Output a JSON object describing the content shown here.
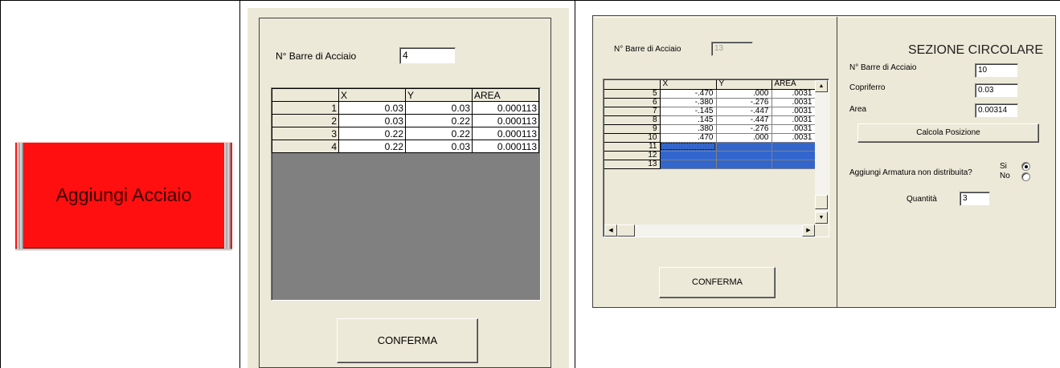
{
  "left_panel": {
    "button_label": "Aggiungi Acciaio"
  },
  "middle_form": {
    "bars_label": "N° Barre di Acciaio",
    "bars_value": "4",
    "table": {
      "headers": [
        "X",
        "Y",
        "AREA"
      ],
      "rows": [
        {
          "n": "1",
          "x": "0.03",
          "y": "0.03",
          "area": "0.000113"
        },
        {
          "n": "2",
          "x": "0.03",
          "y": "0.22",
          "area": "0.000113"
        },
        {
          "n": "3",
          "x": "0.22",
          "y": "0.22",
          "area": "0.000113"
        },
        {
          "n": "4",
          "x": "0.22",
          "y": "0.03",
          "area": "0.000113"
        }
      ]
    },
    "confirm_label": "CONFERMA"
  },
  "right_form": {
    "bars_label": "N° Barre di Acciaio",
    "bars_value": "13",
    "table": {
      "headers": [
        "X",
        "Y",
        "AREA"
      ],
      "rows": [
        {
          "n": "5",
          "x": "-.470",
          "y": ".000",
          "area": ".0031"
        },
        {
          "n": "6",
          "x": "-.380",
          "y": "-.276",
          "area": ".0031"
        },
        {
          "n": "7",
          "x": "-.145",
          "y": "-.447",
          "area": ".0031"
        },
        {
          "n": "8",
          "x": ".145",
          "y": "-.447",
          "area": ".0031"
        },
        {
          "n": "9",
          "x": ".380",
          "y": "-.276",
          "area": ".0031"
        },
        {
          "n": "10",
          "x": ".470",
          "y": ".000",
          "area": ".0031"
        },
        {
          "n": "11",
          "x": "",
          "y": "",
          "area": ""
        },
        {
          "n": "12",
          "x": "",
          "y": "",
          "area": ""
        },
        {
          "n": "13",
          "x": "",
          "y": "",
          "area": ""
        }
      ]
    },
    "confirm_label": "CONFERMA",
    "section": {
      "title": "SEZIONE CIRCOLARE",
      "bars_label": "N° Barre di Acciaio",
      "bars_value": "10",
      "cover_label": "Copriferro",
      "cover_value": "0.03",
      "area_label": "Area",
      "area_value": "0.00314",
      "calc_button": "Calcola Posizione",
      "extra_question": "Aggiungi  Armatura non distribuita?",
      "yes_label": "Si",
      "no_label": "No",
      "yes_selected": true,
      "quantity_label": "Quantità",
      "quantity_value": "3"
    }
  }
}
